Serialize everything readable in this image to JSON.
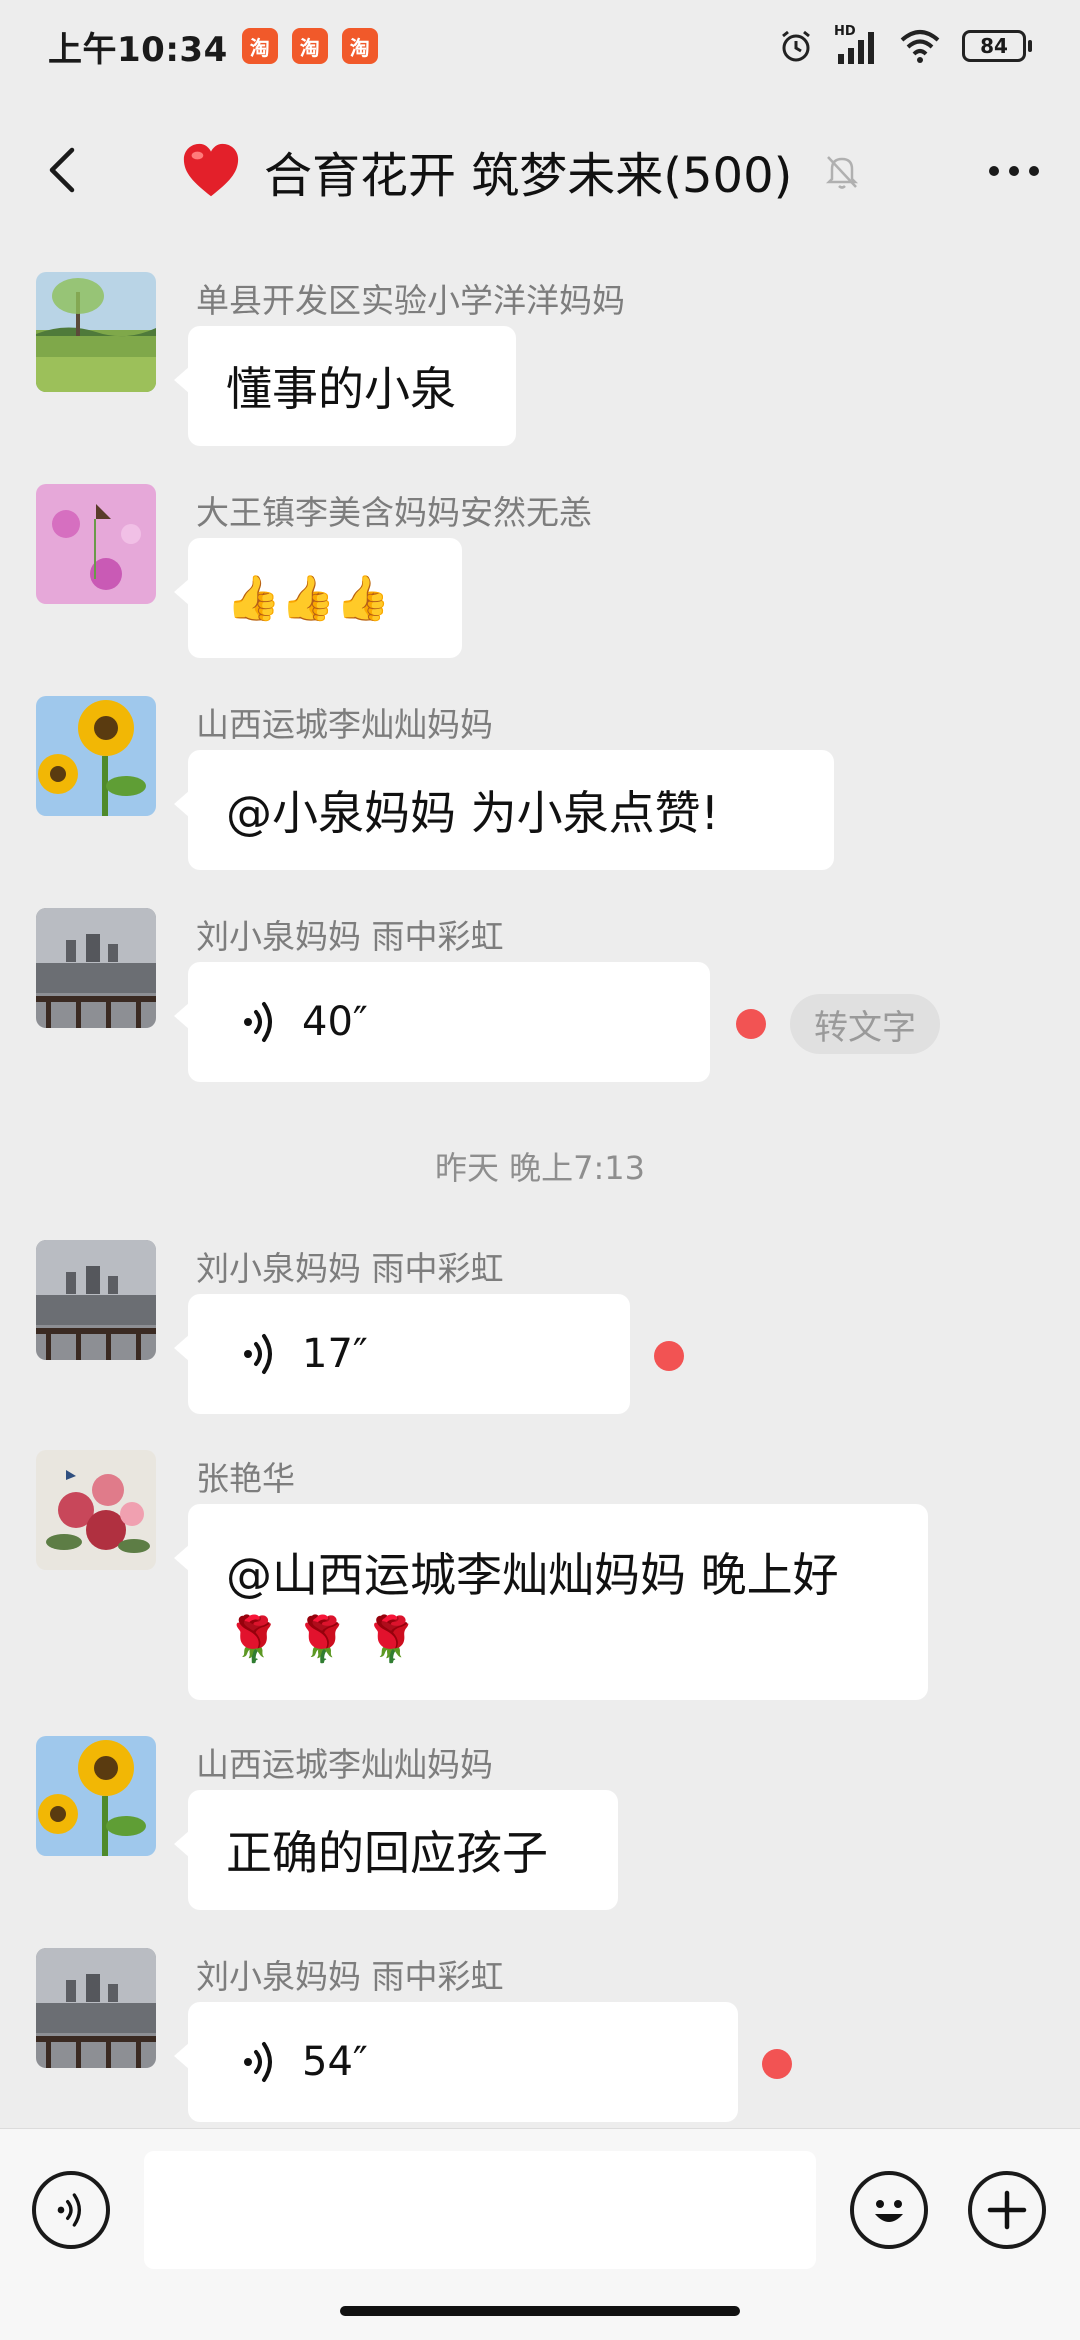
{
  "status_bar": {
    "time": "上午10:34",
    "app_icons": [
      "淘",
      "淘",
      "淘"
    ],
    "battery": "84",
    "network": "HD"
  },
  "header": {
    "title": "合育花开 筑梦未来(500)"
  },
  "messages": [
    {
      "sender": "单县开发区实验小学洋洋妈妈",
      "text": "懂事的小泉"
    },
    {
      "sender": "大王镇李美含妈妈安然无恙",
      "text": "👍👍👍"
    },
    {
      "sender": "山西运城李灿灿妈妈",
      "text": "@小泉妈妈  为小泉点赞!"
    },
    {
      "sender": "刘小泉妈妈  雨中彩虹",
      "voice": "40″",
      "action": "转文字"
    },
    {
      "sender": "刘小泉妈妈  雨中彩虹",
      "voice": "17″"
    },
    {
      "sender": "张艳华",
      "text_line1": "@山西运城李灿灿妈妈  晚上好",
      "text_line2": "🌹 🌹 🌹"
    },
    {
      "sender": "山西运城李灿灿妈妈",
      "text": "正确的回应孩子"
    },
    {
      "sender": "刘小泉妈妈  雨中彩虹",
      "voice": "54″"
    }
  ],
  "timestamp": "昨天 晚上7:13",
  "colors": {
    "background": "#ededed",
    "bubble": "#ffffff",
    "unread_dot": "#f25353",
    "sender_name": "#7d7d7d"
  }
}
